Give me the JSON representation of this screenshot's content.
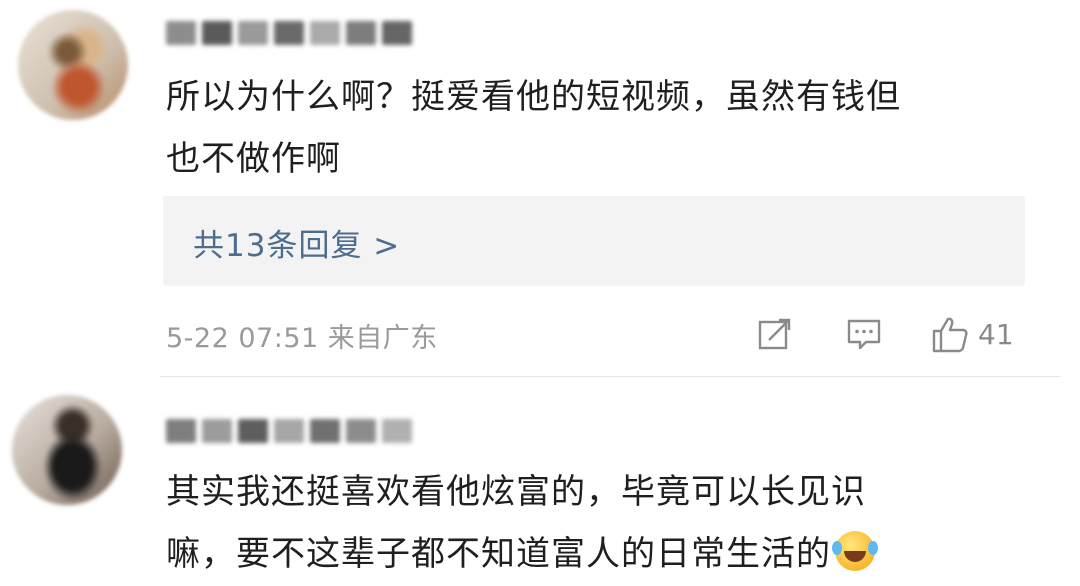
{
  "comments": [
    {
      "content_line1": "所以为什么啊？挺爱看他的短视频，虽然有钱但",
      "content_line2": "也不做作啊",
      "reply_link": "共13条回复 >",
      "meta": "5-22 07:51 来自广东",
      "likes": "41",
      "icons": [
        "repost-icon",
        "comment-icon",
        "like-icon"
      ]
    },
    {
      "content_line1": "其实我还挺喜欢看他炫富的，毕竟可以长见识",
      "content_line2": "嘛，要不这辈子都不知道富人的日常生活的",
      "emoji": "laughing-crying-emoji"
    }
  ],
  "colors": {
    "link": "#4d6d8f",
    "meta": "#9a9a9a",
    "text": "#1f1f1f",
    "reply_bg": "#f3f3f3"
  }
}
